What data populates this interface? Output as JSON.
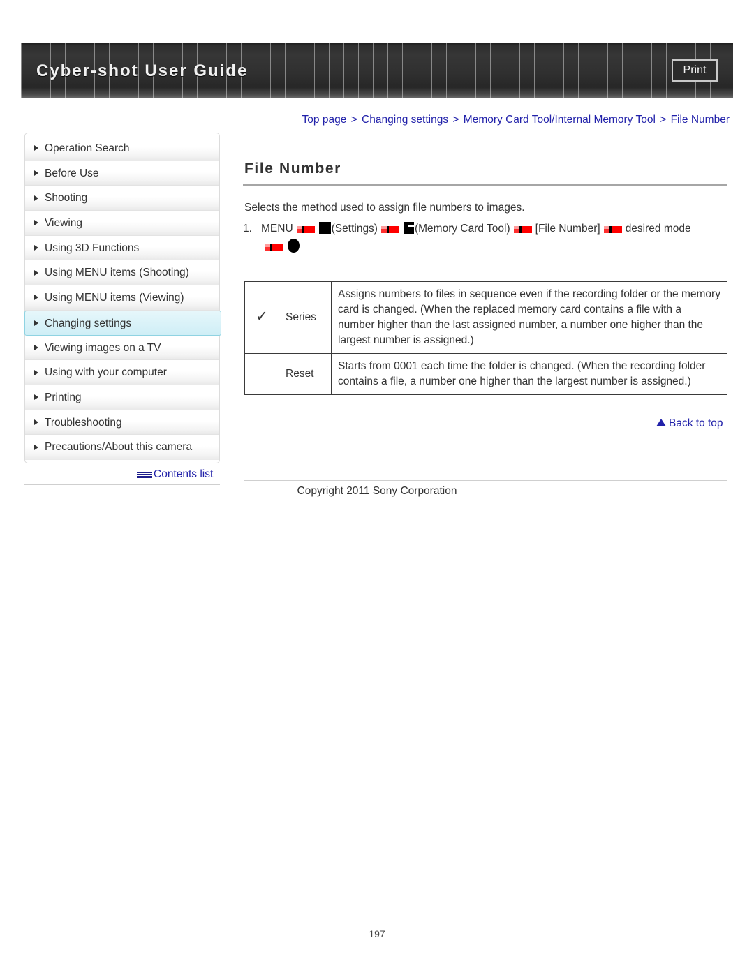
{
  "header": {
    "title": "Cyber-shot User Guide",
    "print_label": "Print"
  },
  "breadcrumb": {
    "items": [
      "Top page",
      "Changing settings",
      "Memory Card Tool/Internal Memory Tool",
      "File Number"
    ],
    "separator": ">",
    "color": "#2222aa"
  },
  "sidebar": {
    "items": [
      {
        "label": "Operation Search",
        "active": false
      },
      {
        "label": "Before Use",
        "active": false
      },
      {
        "label": "Shooting",
        "active": false
      },
      {
        "label": "Viewing",
        "active": false
      },
      {
        "label": "Using 3D Functions",
        "active": false
      },
      {
        "label": "Using MENU items (Shooting)",
        "active": false
      },
      {
        "label": "Using MENU items (Viewing)",
        "active": false
      },
      {
        "label": "Changing settings",
        "active": true
      },
      {
        "label": "Viewing images on a TV",
        "active": false
      },
      {
        "label": "Using with your computer",
        "active": false
      },
      {
        "label": "Printing",
        "active": false
      },
      {
        "label": "Troubleshooting",
        "active": false
      },
      {
        "label": "Precautions/About this camera",
        "active": false
      }
    ],
    "contents_list_label": "Contents list",
    "contents_list_icon": "contents-list-icon",
    "active_color": "#cfeef6"
  },
  "main": {
    "title": "File Number",
    "intro": "Selects the method used to assign file numbers to images.",
    "step": {
      "number": "1.",
      "menu_label": "MENU",
      "settings_label": "(Settings)",
      "memory_card_tool_label": "(Memory Card Tool)",
      "file_number_label": "[File Number]",
      "desired_mode_label": "desired mode",
      "settings_icon": "settings-square-icon",
      "memory_card_icon": "memory-card-tool-icon",
      "confirm_icon": "center-button-dot-icon",
      "arrow_icon": "red-arrow-icon"
    },
    "table": {
      "rows": [
        {
          "checked": true,
          "check_glyph": "✓",
          "label": "Series",
          "description": "Assigns numbers to files in sequence even if the recording folder or the memory card is changed. (When the replaced memory card contains a file with a number higher than the last assigned number, a number one higher than the largest number is assigned.)"
        },
        {
          "checked": false,
          "check_glyph": "",
          "label": "Reset",
          "description": "Starts from 0001 each time the folder is changed. (When the recording folder contains a file, a number one higher than the largest number is assigned.)"
        }
      ]
    },
    "back_to_top_label": "Back to top",
    "back_to_top_icon": "up-triangle-icon"
  },
  "footer": {
    "copyright": "Copyright 2011 Sony Corporation",
    "page_number": "197"
  }
}
